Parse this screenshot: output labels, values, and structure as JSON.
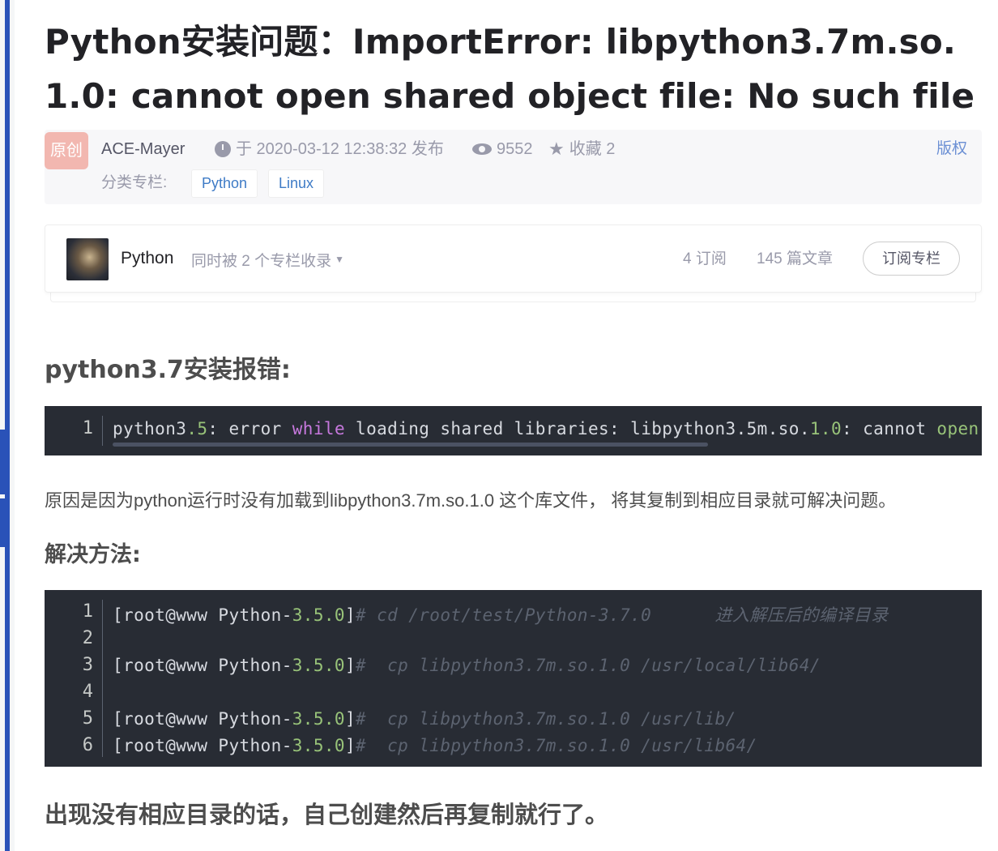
{
  "article": {
    "title": "Python安装问题：ImportError: libpython3.7m.so.1.0: cannot open shared object file: No such file or direct"
  },
  "meta": {
    "badge": "原创",
    "author": "ACE-Mayer",
    "publish": "于 2020-03-12 12:38:32 发布",
    "views": "9552",
    "favorites": "收藏 2",
    "copyright": "版权",
    "category_label": "分类专栏:",
    "tags": [
      "Python",
      "Linux"
    ]
  },
  "column": {
    "name": "Python",
    "included": "同时被 2 个专栏收录",
    "subscribers": "4 订阅",
    "articles": "145 篇文章",
    "subscribe_button": "订阅专栏"
  },
  "sections": {
    "error_heading": "python3.7安装报错:",
    "reason": "原因是因为python运行时没有加载到libpython3.7m.so.1.0 这个库文件， 将其复制到相应目录就可解决问题。",
    "solution_heading": "解决方法:",
    "closing": "出现没有相应目录的话，自己创建然后再复制就行了。"
  },
  "code_error": {
    "line_numbers": [
      "1"
    ],
    "p1": "python3",
    "p2": ".5",
    "p3": ": error ",
    "p4": "while",
    "p5": " loading shared libraries: libpython3.5m.so.",
    "p6": "1.0",
    "p7": ": cannot ",
    "p8": "open"
  },
  "code_solution": {
    "line_numbers": [
      "1",
      "2",
      "3",
      "4",
      "5",
      "6"
    ],
    "prompt_a": "[root@www Python-",
    "prompt_v": "3.5.0",
    "prompt_b": "]",
    "cmd1": "# cd /root/test/Python-3.7.0      进入解压后的编译目录",
    "cmd3": "#  cp libpython3.7m.so.1.0 /usr/local/lib64/",
    "cmd5": "#  cp libpython3.7m.so.1.0 /usr/lib/",
    "cmd6": "#  cp libpython3.7m.so.1.0 /usr/lib64/"
  },
  "colors": {
    "code_bg": "#282c34",
    "link": "#3e7bc6",
    "badge": "#f2b7b0",
    "left_rail": "#2a52b8"
  },
  "icons": [
    "clock-icon",
    "eye-icon",
    "star-icon",
    "caret-down-icon"
  ]
}
